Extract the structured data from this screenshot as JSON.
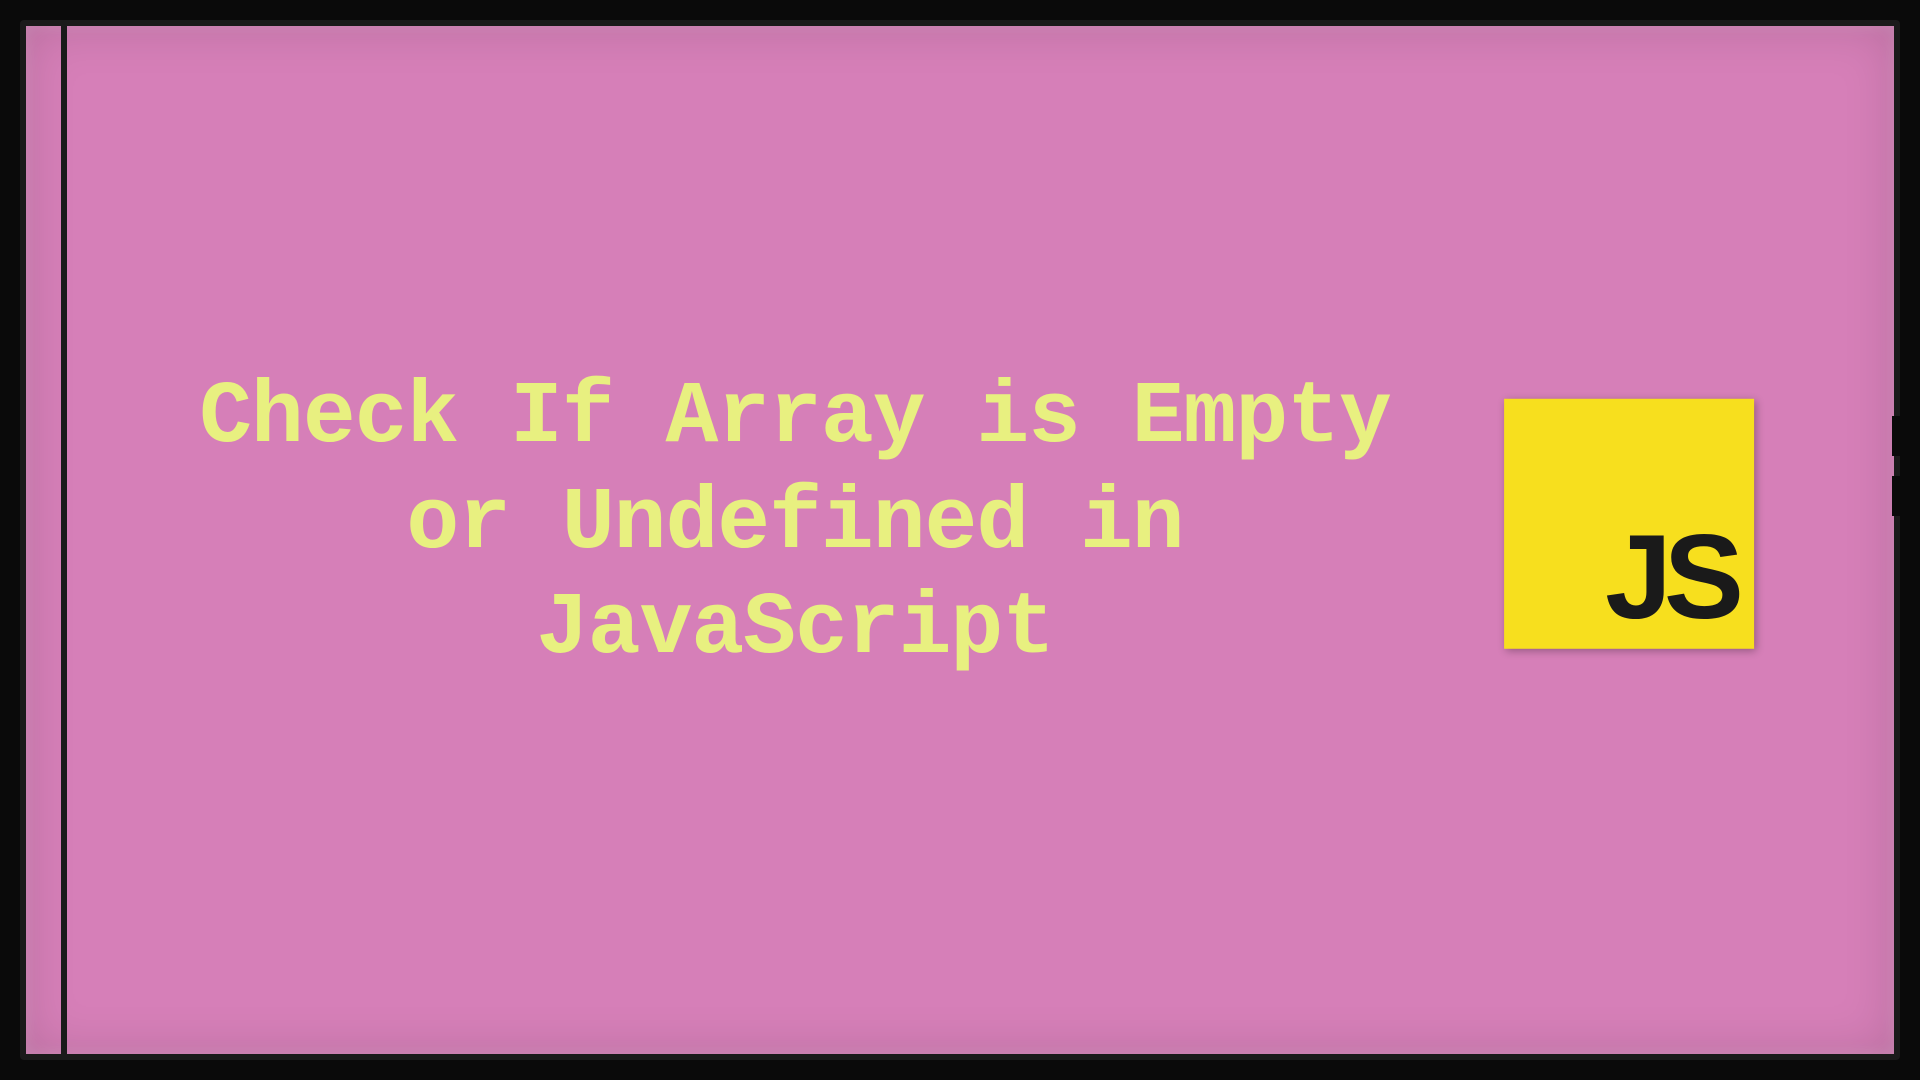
{
  "title": "Check If Array is Empty or Undefined in JavaScript",
  "logo": {
    "text": "JS",
    "background": "#f7df1e",
    "textColor": "#1a1a1a"
  },
  "colors": {
    "background": "#d67fb8",
    "titleColor": "#e8f080",
    "frameBorder": "#1a1a1a"
  }
}
